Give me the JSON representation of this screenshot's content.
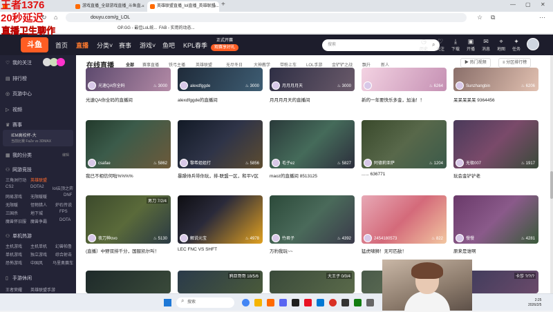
{
  "browser": {
    "tabs": [
      {
        "label": "游戏直播_全部游戏直播_斗鱼直..."
      },
      {
        "label": "英雄联盟直播_lol直播_英雄联盟..."
      }
    ],
    "new_tab": "+",
    "url": "douyu.com/g_LOL",
    "bookmarks": [
      "OP.GG - 最佳LoL统...",
      "FAB - 实用的动态..."
    ]
  },
  "overlay": {
    "line1": "王者1376",
    "line2": "20秒延迟",
    "line3": "直播卫生聊作"
  },
  "header": {
    "logo": "斗鱼",
    "nav": [
      {
        "label": "首页"
      },
      {
        "label": "直播",
        "active": true
      },
      {
        "label": "分类",
        "has_arrow": true
      },
      {
        "label": "赛事"
      },
      {
        "label": "游戏",
        "has_arrow": true
      },
      {
        "label": "鱼吧"
      },
      {
        "label": "KPL春季"
      }
    ],
    "promo": {
      "line1": "正式开赛",
      "line2": "观赛享好礼"
    },
    "search_placeholder": "搜索",
    "icons": [
      {
        "name": "history",
        "label": "历史"
      },
      {
        "name": "follow",
        "label": "关注"
      },
      {
        "name": "download",
        "label": "下载"
      },
      {
        "name": "broadcast",
        "label": "开播"
      },
      {
        "name": "message",
        "label": "消息"
      },
      {
        "name": "tasks",
        "label": "任务"
      },
      {
        "name": "location",
        "label": "地图"
      },
      {
        "name": "gift",
        "label": "任务"
      }
    ]
  },
  "sidebar": {
    "items": [
      {
        "label": "我的关注",
        "icon": "heart"
      },
      {
        "label": "排行榜",
        "icon": "rank"
      },
      {
        "label": "页游中心",
        "icon": "game"
      },
      {
        "label": "视频",
        "icon": "video"
      },
      {
        "label": "赛事",
        "icon": "trophy"
      }
    ],
    "event_title": "IEM高校杯-大",
    "event_sub": "当前比赛 FaZe vs 3DMAX",
    "my_category": "我的分类",
    "my_category_action": "编辑",
    "section_net": "网游竞技",
    "net_grid": [
      "三角洲行动",
      "英雄联盟",
      "CS2",
      "DOTA2",
      "网易游戏",
      "无限暖暖",
      "无限暖",
      "怪物猎人",
      "地下城",
      "三国杀",
      "魔兽怀旧服",
      "魔兽争霸"
    ],
    "net_grid2": [
      "穿越火线",
      "lol云顶之弈",
      "DNF",
      "炉石传说",
      "FPS",
      "DOTA"
    ],
    "section_single": "单机热游",
    "single_grid": [
      "主机游戏",
      "主机单机",
      "综合射击",
      "单机游戏",
      "独立游戏",
      "体育游戏",
      "恐怖游戏",
      "中国风",
      "枪战游戏"
    ],
    "single_grid2": [
      "幻兽帕鲁",
      "怪物猎人",
      "马里奥赛车"
    ],
    "section_mobile": "手游休闲",
    "mobile_grid": [
      "王者荣耀",
      "英雄联盟手游"
    ]
  },
  "content": {
    "title": "在线直播",
    "categories": [
      {
        "label": "全部",
        "active": true
      },
      {
        "label": "赛事直播"
      },
      {
        "label": "铁弓主播"
      },
      {
        "label": "英雄联盟"
      },
      {
        "label": "无尽冬日"
      },
      {
        "label": "大神教学"
      },
      {
        "label": "带粉上车"
      },
      {
        "label": "LOL手游"
      },
      {
        "label": "金铲铲之战"
      },
      {
        "label": "飘升"
      },
      {
        "label": "新人"
      }
    ],
    "buttons": {
      "hot": "热门视频",
      "rank": "分区排行榜"
    },
    "row0": [
      {
        "streamer": "光速QA你全码",
        "views": "3000",
        "title": "光速QA你全码的直播间"
      },
      {
        "streamer": "alexdfggde",
        "views": "3000",
        "title": "alexdfggde的直播间"
      },
      {
        "streamer": "月月月月天",
        "views": "3000",
        "title": "月月月月天的直播间"
      },
      {
        "streamer": "",
        "views": "6264",
        "title": "新的一年要快乐多金，加油！！"
      },
      {
        "streamer": "Sunzhangbin",
        "views": "6206",
        "title": "呆呆呆呆呆 9364456"
      }
    ],
    "row1": [
      {
        "streamer": "csafae",
        "views": "5862",
        "title": "我已不相信何啦%%%%"
      },
      {
        "streamer": "黎希姐姐打",
        "views": "5856",
        "title": "暴躁帅兵带你玩，排-联盟一区，和平V区"
      },
      {
        "streamer": "毛子ez",
        "views": "5827",
        "title": "maoz的直播间 8513125"
      },
      {
        "streamer": "阿德莉亚萨",
        "views": "1204",
        "title": "...... 636771"
      },
      {
        "streamer": "无极007",
        "views": "1917",
        "title": "玩会金铲铲老"
      }
    ],
    "row2": [
      {
        "streamer": "夜刀神ovo",
        "views": "5130",
        "tag": "男刀 7/2/4",
        "title": "(直播）中野双排千分，国服凯尔叫！"
      },
      {
        "streamer": "解说元宝",
        "views": "4978",
        "tag": "",
        "title": "LEC FNC VS SHFT"
      },
      {
        "streamer": "竹君子",
        "views": "4392",
        "tag": "",
        "title": "万豹我玩~~"
      },
      {
        "streamer": "2454180573",
        "views": "822",
        "tag": "",
        "title": "猛虎啸狮！无可匹敌！"
      },
      {
        "streamer": "慢慢",
        "views": "4281",
        "tag": "",
        "title": "原来是谁啊"
      }
    ],
    "row3": [
      {
        "tag": ""
      },
      {
        "tag": "鸦亚哥哥 18/5/6"
      },
      {
        "tag": "大王子 0/0/4"
      },
      {
        "tag": ""
      },
      {
        "tag": "卡莎 ?/?/?"
      }
    ]
  },
  "taskbar": {
    "search": "搜索",
    "time": "2:25",
    "date": "2026/2/5"
  }
}
